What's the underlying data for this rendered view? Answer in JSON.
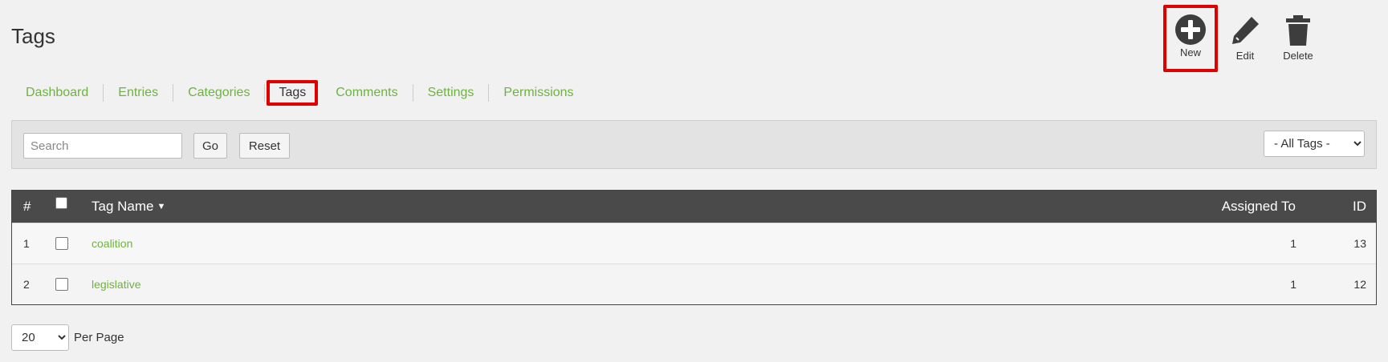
{
  "page": {
    "title": "Tags"
  },
  "toolbar": {
    "new_label": "New",
    "edit_label": "Edit",
    "delete_label": "Delete",
    "new_icon": "plus-circle-icon",
    "edit_icon": "pencil-icon",
    "delete_icon": "trash-icon"
  },
  "nav": {
    "items": [
      {
        "label": "Dashboard"
      },
      {
        "label": "Entries"
      },
      {
        "label": "Categories"
      },
      {
        "label": "Tags",
        "active": true
      },
      {
        "label": "Comments"
      },
      {
        "label": "Settings"
      },
      {
        "label": "Permissions"
      }
    ]
  },
  "filter": {
    "search_placeholder": "Search",
    "search_value": "",
    "go_label": "Go",
    "reset_label": "Reset",
    "tags_select": "- All Tags -"
  },
  "table": {
    "columns": {
      "num": "#",
      "name": "Tag Name",
      "assigned": "Assigned To",
      "id": "ID"
    },
    "sort_indicator": "▼",
    "rows": [
      {
        "num": "1",
        "name": "coalition",
        "assigned": "1",
        "id": "13"
      },
      {
        "num": "2",
        "name": "legislative",
        "assigned": "1",
        "id": "12"
      }
    ]
  },
  "footer": {
    "per_page_value": "20",
    "per_page_label": "Per Page"
  },
  "colors": {
    "accent_green": "#6db33f",
    "highlight_red": "#e00000",
    "header_dark": "#4a4a4a"
  }
}
